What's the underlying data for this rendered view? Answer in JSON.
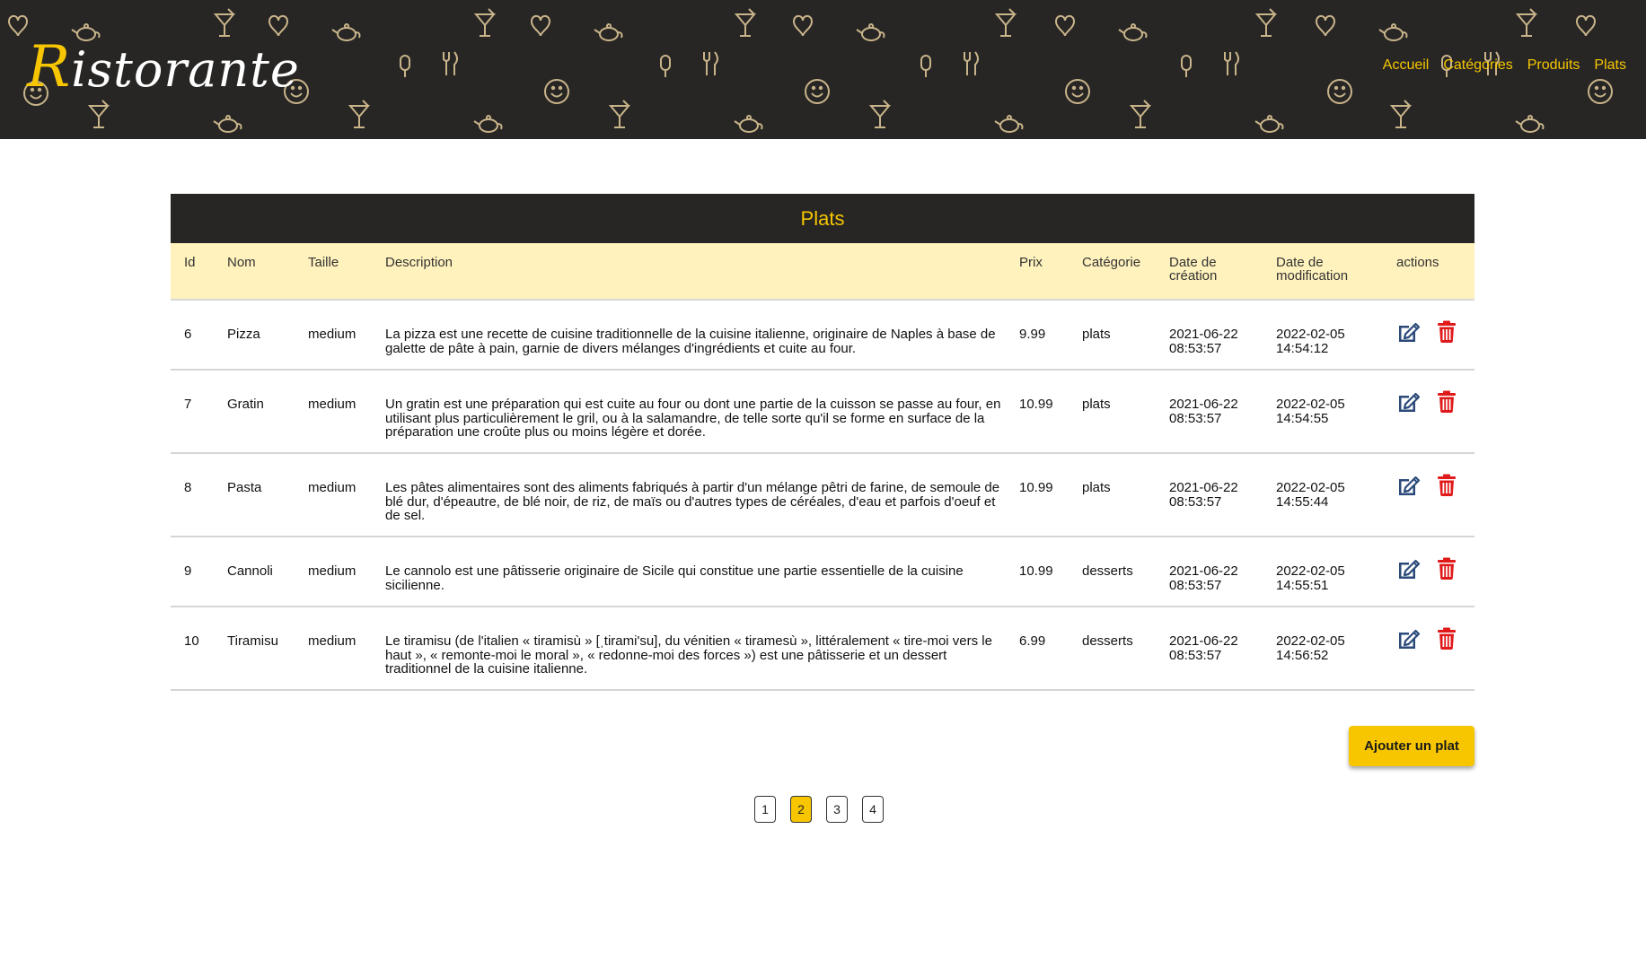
{
  "app": {
    "logo_first_letter": "R",
    "logo_rest": "istorante"
  },
  "nav": {
    "items": [
      "Accueil",
      "Catégories",
      "Produits",
      "Plats"
    ]
  },
  "table": {
    "title": "Plats",
    "headers": {
      "id": "Id",
      "nom": "Nom",
      "taille": "Taille",
      "description": "Description",
      "prix": "Prix",
      "categorie": "Catégorie",
      "created_line1": "Date de",
      "created_line2": "création",
      "modified_line1": "Date de",
      "modified_line2": "modification",
      "actions": "actions"
    },
    "rows": [
      {
        "id": "6",
        "nom": "Pizza",
        "taille": "medium",
        "description": "La pizza est une recette de cuisine traditionnelle de la cuisine italienne, originaire de Naples à base de galette de pâte à pain, garnie de divers mélanges d'ingrédients et cuite au four.",
        "prix": "9.99",
        "categorie": "plats",
        "created_date": "2021-06-22",
        "created_time": "08:53:57",
        "modified_date": "2022-02-05",
        "modified_time": "14:54:12"
      },
      {
        "id": "7",
        "nom": "Gratin",
        "taille": "medium",
        "description": "Un gratin est une préparation qui est cuite au four ou dont une partie de la cuisson se passe au four, en utilisant plus particulièrement le gril, ou à la salamandre, de telle sorte qu'il se forme en surface de la préparation une croûte plus ou moins légère et dorée.",
        "prix": "10.99",
        "categorie": "plats",
        "created_date": "2021-06-22",
        "created_time": "08:53:57",
        "modified_date": "2022-02-05",
        "modified_time": "14:54:55"
      },
      {
        "id": "8",
        "nom": "Pasta",
        "taille": "medium",
        "description": "Les pâtes alimentaires sont des aliments fabriqués à partir d'un mélange pêtri de farine, de semoule de blé dur, d'épeautre, de blé noir, de riz, de maïs ou d'autres types de céréales, d'eau et parfois d'oeuf et de sel.",
        "prix": "10.99",
        "categorie": "plats",
        "created_date": "2021-06-22",
        "created_time": "08:53:57",
        "modified_date": "2022-02-05",
        "modified_time": "14:55:44"
      },
      {
        "id": "9",
        "nom": "Cannoli",
        "taille": "medium",
        "description": "Le cannolo est une pâtisserie originaire de Sicile qui constitue une partie essentielle de la cuisine sicilienne.",
        "prix": "10.99",
        "categorie": "desserts",
        "created_date": "2021-06-22",
        "created_time": "08:53:57",
        "modified_date": "2022-02-05",
        "modified_time": "14:55:51"
      },
      {
        "id": "10",
        "nom": "Tiramisu",
        "taille": "medium",
        "description": "Le tiramisu (de l'italien « tiramisù » [ˌtirami'su], du vénitien « tiramesù », littéralement « tire-moi vers le haut », « remonte-moi le moral », « redonne-moi des forces ») est une pâtisserie et un dessert traditionnel de la cuisine italienne.",
        "prix": "6.99",
        "categorie": "desserts",
        "created_date": "2021-06-22",
        "created_time": "08:53:57",
        "modified_date": "2022-02-05",
        "modified_time": "14:56:52"
      }
    ]
  },
  "actions": {
    "edit_icon": "edit-icon",
    "delete_icon": "trash-icon",
    "add_label": "Ajouter un plat"
  },
  "pagination": {
    "pages": [
      "1",
      "2",
      "3",
      "4"
    ],
    "current": "2"
  },
  "colors": {
    "header_bg": "#272625",
    "accent": "#f7c600",
    "table_header_bg": "#fff2bd",
    "edit_icon": "#2b4a7a",
    "delete_icon": "#e01a1a"
  }
}
